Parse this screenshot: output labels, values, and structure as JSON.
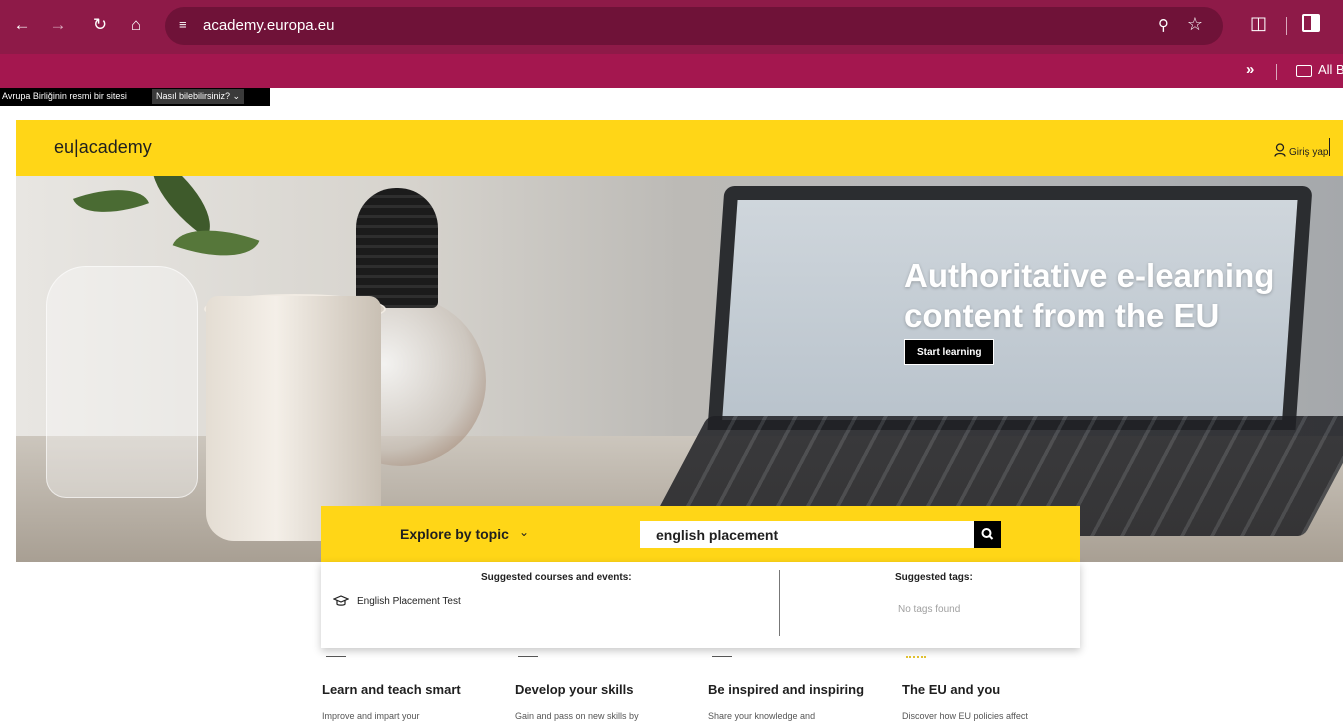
{
  "browser": {
    "url": "academy.europa.eu",
    "bookmarks_more": "»",
    "bookmarks_folder_label": "All B"
  },
  "eu_bar": {
    "official_text": "Avrupa Birliğinin resmi bir sitesi",
    "how_to_know": "Nasıl bilebilirsiniz? ⌄"
  },
  "header": {
    "logo": "eu|academy",
    "login": "Giriş yap"
  },
  "hero": {
    "title": "Authoritative e-learning content from the EU",
    "cta": "Start learning"
  },
  "search": {
    "explore_label": "Explore by topic",
    "chevron": "⌄",
    "query": "english placement"
  },
  "dropdown": {
    "courses_heading": "Suggested courses and events:",
    "course_item": "English Placement Test",
    "tags_heading": "Suggested tags:",
    "no_tags": "No tags found"
  },
  "features": [
    {
      "title": "Learn and teach smart",
      "desc": "Improve and impart your"
    },
    {
      "title": "Develop your skills",
      "desc": "Gain and pass on new skills by"
    },
    {
      "title": "Be inspired and inspiring",
      "desc": "Share your knowledge and"
    },
    {
      "title": "The EU and you",
      "desc": "Discover how EU policies affect"
    }
  ],
  "colors": {
    "chrome_bar": "#8e1a48",
    "bookmarks_bar": "#a4174f",
    "eu_yellow": "#ffd617"
  }
}
